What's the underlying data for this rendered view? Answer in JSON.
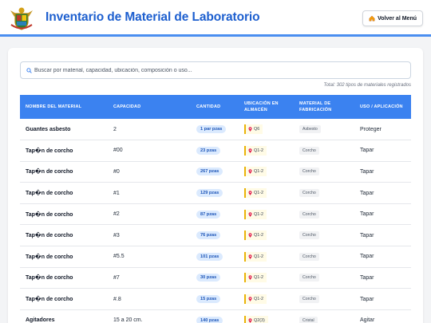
{
  "header": {
    "title": "Inventario de Material de Laboratorio",
    "back_label": "Volver al Menú"
  },
  "search": {
    "placeholder": "Buscar por material, capacidad, ubicación, composición o uso..."
  },
  "total_label": "Total: 302 tipos de materiales registrados",
  "table": {
    "columns": [
      "NOMBRE DEL MATERIAL",
      "CAPACIDAD",
      "CANTIDAD",
      "UBICACIÓN EN ALMACÉN",
      "MATERIAL DE FABRICACIÓN",
      "USO / APLICACIÓN"
    ],
    "rows": [
      {
        "name": "Guantes asbesto",
        "capacity": "2",
        "qty": "1 par pzas",
        "location": "Q6",
        "material": "Asbesto",
        "use": "Proteger"
      },
      {
        "name": "Tap�n de corcho",
        "capacity": "#00",
        "qty": "23 pzas",
        "location": "Q1-2",
        "material": "Corcho",
        "use": "Tapar"
      },
      {
        "name": "Tap�n de corcho",
        "capacity": "#0",
        "qty": "267 pzas",
        "location": "Q1-2",
        "material": "Corcho",
        "use": "Tapar"
      },
      {
        "name": "Tap�n de corcho",
        "capacity": "#1",
        "qty": "129 pzas",
        "location": "Q1-2",
        "material": "Corcho",
        "use": "Tapar"
      },
      {
        "name": "Tap�n de corcho",
        "capacity": "#2",
        "qty": "87 pzas",
        "location": "Q1-2",
        "material": "Corcho",
        "use": "Tapar"
      },
      {
        "name": "Tap�n de corcho",
        "capacity": "#3",
        "qty": "76 pzas",
        "location": "Q1-2",
        "material": "Corcho",
        "use": "Tapar"
      },
      {
        "name": "Tap�n de corcho",
        "capacity": "#5.5",
        "qty": "101 pzas",
        "location": "Q1-2",
        "material": "Corcho",
        "use": "Tapar"
      },
      {
        "name": "Tap�n de corcho",
        "capacity": "#7",
        "qty": "30 pzas",
        "location": "Q1-2",
        "material": "Corcho",
        "use": "Tapar"
      },
      {
        "name": "Tap�n de corcho",
        "capacity": "#.8",
        "qty": "15 pzas",
        "location": "Q1-2",
        "material": "Corcho",
        "use": "Tapar"
      },
      {
        "name": "Agitadores",
        "capacity": "15 a 20 cm.",
        "qty": "140 pzas",
        "location": "Q2(3)",
        "material": "Cristal",
        "use": "Agitar"
      }
    ]
  },
  "icons": {
    "logo": "coat-of-arms-logo",
    "home": "home-icon",
    "search": "search-icon",
    "location": "pin-icon"
  },
  "colors": {
    "accent": "#1d5fcf",
    "header_bar": "#3b82f0",
    "qty_badge_bg": "#dbeafe",
    "location_border": "#eab308"
  }
}
